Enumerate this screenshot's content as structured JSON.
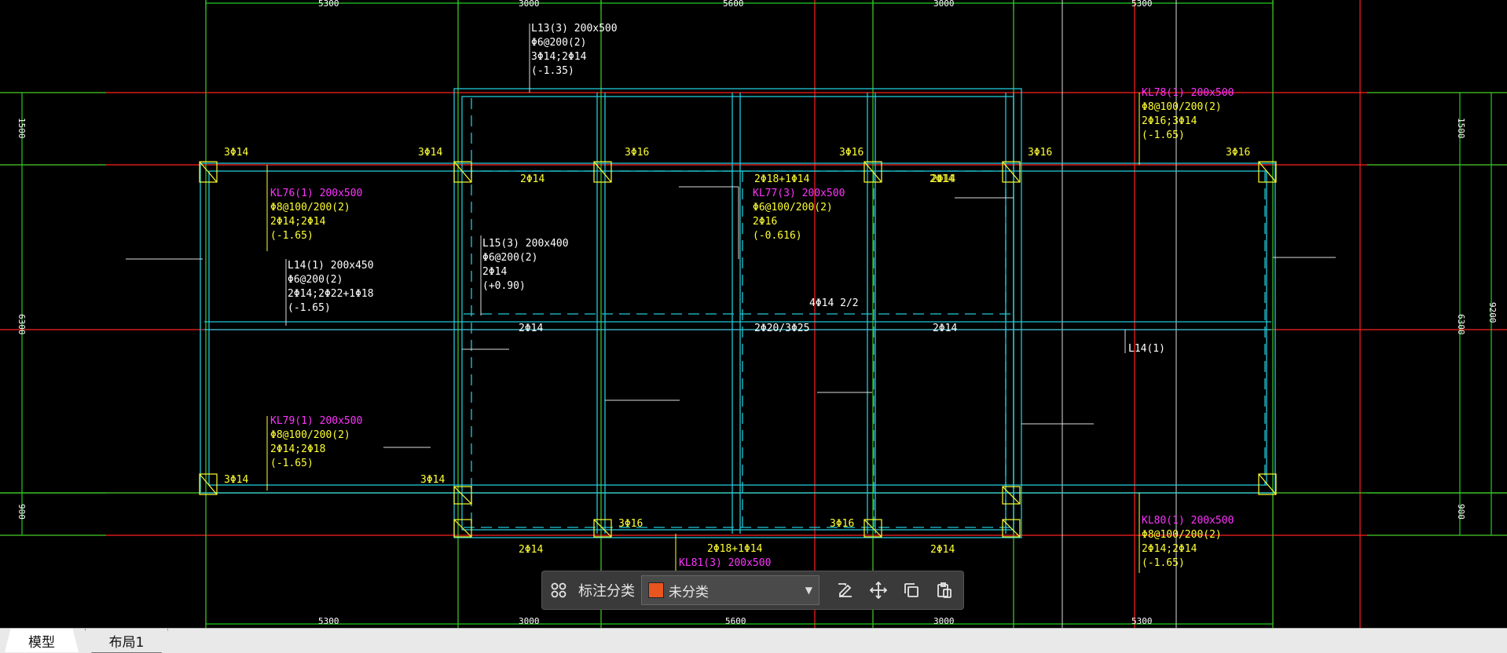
{
  "colors": {
    "background": "#000000",
    "axis_red": "#ff2020",
    "axis_green": "#22cc22",
    "beam_cyan": "#22c8d8",
    "text_yellow": "#ffff33",
    "text_magenta": "#ff33ff",
    "text_white": "#ffffff",
    "swatch_orange": "#e8551e"
  },
  "drawing": {
    "dims_top": [
      "5300",
      "3000",
      "5600",
      "3000",
      "5300"
    ],
    "dims_bottom": [
      "5300",
      "3000",
      "5600",
      "3000",
      "5300"
    ],
    "dims_left": [
      "1500",
      "6300",
      "900"
    ],
    "dims_right": [
      "1500",
      "6300",
      "900",
      "9200"
    ],
    "annotations": {
      "l13_1": "L13(3) 200x500",
      "l13_2": "Φ6@200(2)",
      "l13_3": "3Φ14;2Φ14",
      "l13_4": "(-1.35)",
      "kl76_1": "KL76(1) 200x500",
      "kl76_2": "Φ8@100/200(2)",
      "kl76_3": "2Φ14;2Φ14",
      "kl76_4": "(-1.65)",
      "l14_1": "L14(1) 200x450",
      "l14_2": "Φ6@200(2)",
      "l14_3": "2Φ14;2Φ22+1Φ18",
      "l14_4": "(-1.65)",
      "l15_1": "L15(3) 200x400",
      "l15_2": "Φ6@200(2)",
      "l15_3": "2Φ14",
      "l15_4": "(+0.90)",
      "kl77_0": "2Φ18+1Φ14",
      "kl77_1": "KL77(3) 200x500",
      "kl77_2": "Φ6@100/200(2)",
      "kl77_3": "2Φ16",
      "kl77_4": "(-0.616)",
      "kl79_1": "KL79(1) 200x500",
      "kl79_2": "Φ8@100/200(2)",
      "kl79_3": "2Φ14;2Φ18",
      "kl79_4": "(-1.65)",
      "kl78_1": "KL78(1) 200x500",
      "kl78_2": "Φ8@100/200(2)",
      "kl78_3": "2Φ16;3Φ14",
      "kl78_4": "(-1.65)",
      "kl80_1": "KL80(1) 200x500",
      "kl80_2": "Φ8@100/200(2)",
      "kl80_3": "2Φ14;2Φ14",
      "kl80_4": "(-1.65)",
      "kl81_0": "2Φ18+1Φ14",
      "kl81_1": "KL81(3) 200x500",
      "s_3f14a": "3Φ14",
      "s_3f14b": "3Φ14",
      "s_3f16a": "3Φ16",
      "s_3f16b": "3Φ16",
      "s_3f16c": "3Φ16",
      "s_3f16d": "3Φ16",
      "s_2f14a": "2Φ14",
      "s_2f14b": "2Φ14",
      "s_2f14c": "2Φ14",
      "s_2f14d": "2Φ14",
      "s_2f14e": "2Φ14",
      "s_2f14f": "2Φ14",
      "s_4f14": "4Φ14 2/2",
      "s_2f20": "2Φ20/3Φ25",
      "s_l14r": "L14(1)",
      "s_3f14c": "3Φ14",
      "s_3f14d": "3Φ14",
      "s_3f16e": "3Φ16",
      "s_3f16f": "3Φ16",
      "s_2f14g": "2Φ14",
      "s_2f14h": "2Φ14",
      "s_2f14i": "2Φ14"
    }
  },
  "toolbar": {
    "label": "标注分类",
    "category_value": "未分类"
  },
  "tabs": {
    "model": "模型",
    "layout1": "布局1"
  }
}
